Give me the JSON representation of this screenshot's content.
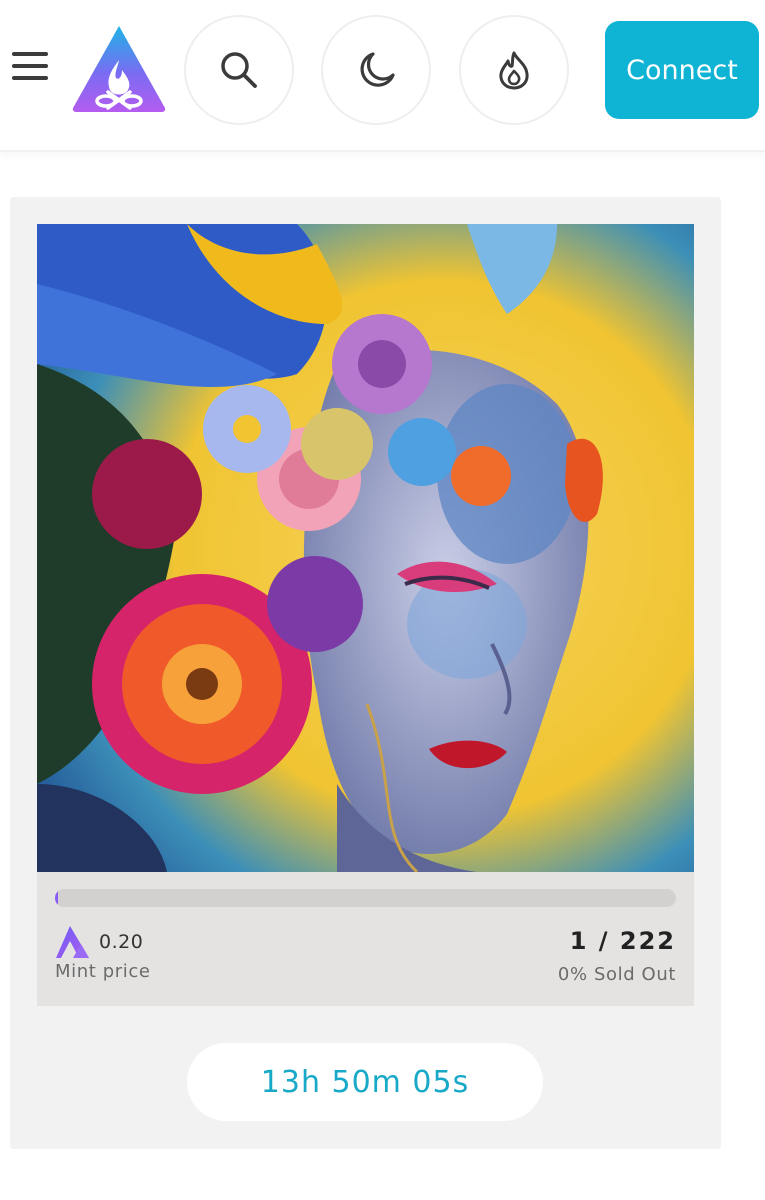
{
  "header": {
    "connect_label": "Connect",
    "icons": [
      "hamburger-menu-icon",
      "brand-logo",
      "search-icon",
      "moon-icon",
      "flame-icon"
    ],
    "accent_color": "#0fb3d3"
  },
  "card": {
    "artwork_description_icon": "artwork-image",
    "mint_price_value": "0.20",
    "mint_price_label": "Mint price",
    "supply": "1 / 222",
    "sold_out": "0% Sold Out",
    "progress_fraction": 0.0045,
    "countdown": "13h 50m 05s"
  }
}
